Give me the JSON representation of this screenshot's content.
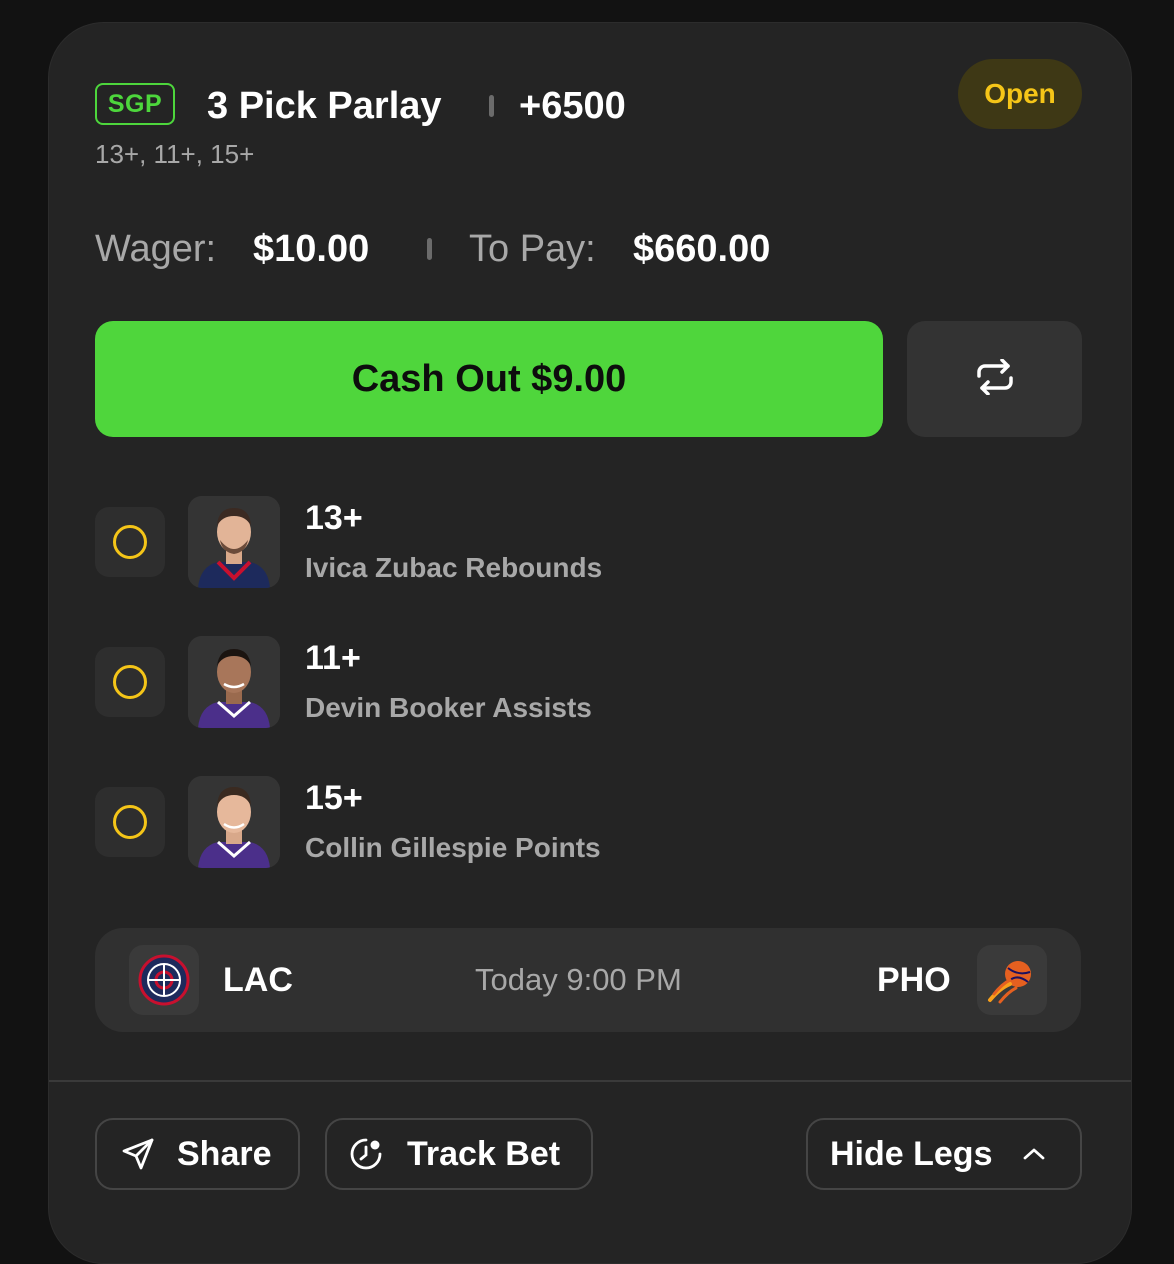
{
  "bet": {
    "badge": "SGP",
    "title": "3 Pick Parlay",
    "odds": "+6500",
    "summary": "13+, 11+, 15+",
    "status": "Open"
  },
  "amounts": {
    "wager_label": "Wager:",
    "wager_value": "$10.00",
    "topay_label": "To Pay:",
    "topay_value": "$660.00"
  },
  "actions": {
    "cashout_label": "Cash Out $9.00",
    "sync_icon": "repeat-arrows-icon"
  },
  "legs": [
    {
      "line": "13+",
      "description": "Ivica Zubac Rebounds"
    },
    {
      "line": "11+",
      "description": "Devin Booker Assists"
    },
    {
      "line": "15+",
      "description": "Collin Gillespie Points"
    }
  ],
  "game": {
    "away_team": "LAC",
    "time": "Today 9:00 PM",
    "home_team": "PHO"
  },
  "footer": {
    "share_label": "Share",
    "track_label": "Track Bet",
    "hide_label": "Hide Legs"
  },
  "colors": {
    "accent_green": "#4fd63c",
    "status_yellow": "#f5c518",
    "card_bg": "#242424"
  }
}
